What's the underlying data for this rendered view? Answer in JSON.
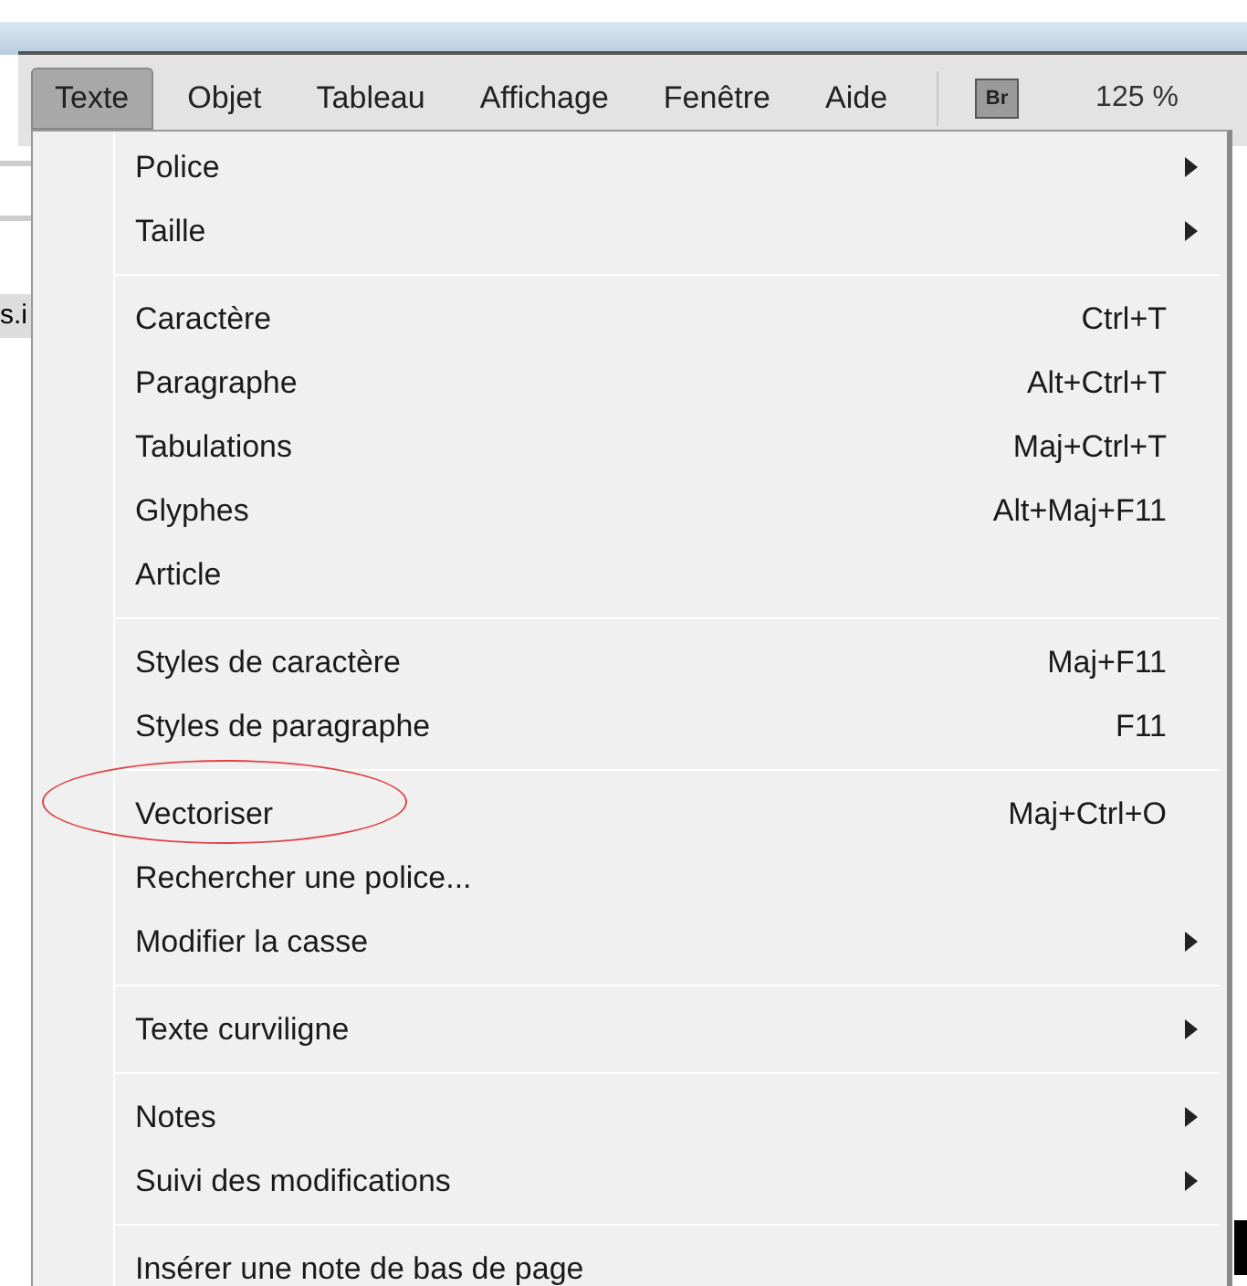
{
  "menu_bar": [
    {
      "label": "Texte",
      "selected": true
    },
    {
      "label": "Objet",
      "selected": false
    },
    {
      "label": "Tableau",
      "selected": false
    },
    {
      "label": "Affichage",
      "selected": false
    },
    {
      "label": "Fenêtre",
      "selected": false
    },
    {
      "label": "Aide",
      "selected": false
    }
  ],
  "bridge_button": "Br",
  "zoom": "125 %",
  "background_fragments": {
    "left": "s.i"
  },
  "menu": [
    [
      {
        "label": "Police",
        "submenu": true,
        "circled": false
      },
      {
        "label": "Taille",
        "submenu": true,
        "circled": false
      }
    ],
    [
      {
        "label": "Caractère",
        "shortcut": "Ctrl+T",
        "submenu": false,
        "circled": false
      },
      {
        "label": "Paragraphe",
        "shortcut": "Alt+Ctrl+T",
        "submenu": false,
        "circled": false
      },
      {
        "label": "Tabulations",
        "shortcut": "Maj+Ctrl+T",
        "submenu": false,
        "circled": false
      },
      {
        "label": "Glyphes",
        "shortcut": "Alt+Maj+F11",
        "submenu": false,
        "circled": false
      },
      {
        "label": "Article",
        "submenu": false,
        "circled": false
      }
    ],
    [
      {
        "label": "Styles de caractère",
        "shortcut": "Maj+F11",
        "submenu": false,
        "circled": false
      },
      {
        "label": "Styles de paragraphe",
        "shortcut": "F11",
        "submenu": false,
        "circled": false
      }
    ],
    [
      {
        "label": "Vectoriser",
        "shortcut": "Maj+Ctrl+O",
        "submenu": false,
        "circled": true
      },
      {
        "label": "Rechercher une police...",
        "submenu": false,
        "circled": false
      },
      {
        "label": "Modifier la casse",
        "submenu": true,
        "circled": false
      }
    ],
    [
      {
        "label": "Texte curviligne",
        "submenu": true,
        "circled": false
      }
    ],
    [
      {
        "label": "Notes",
        "submenu": true,
        "circled": false
      },
      {
        "label": "Suivi des modifications",
        "submenu": true,
        "circled": false
      }
    ],
    [
      {
        "label": "Insérer une note de bas de page",
        "submenu": false,
        "circled": false
      }
    ]
  ]
}
